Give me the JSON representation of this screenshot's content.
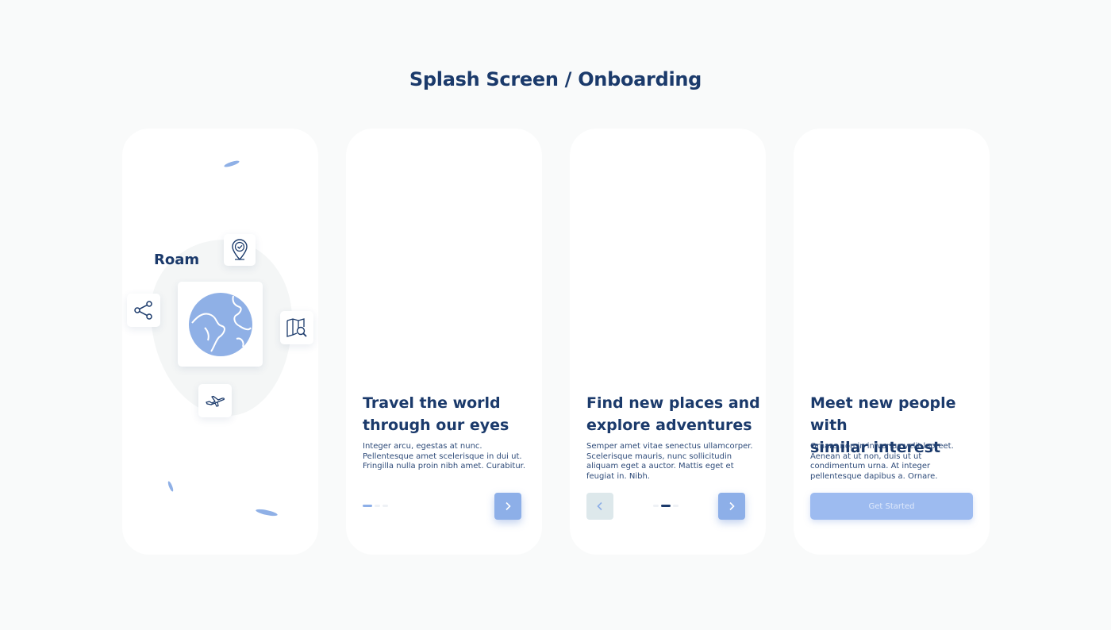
{
  "page": {
    "title": "Splash Screen / Onboarding"
  },
  "splash": {
    "brand": "Roam",
    "icons": [
      "globe-icon",
      "location-check-icon",
      "share-icon",
      "map-search-icon",
      "airplane-icon"
    ]
  },
  "screens": [
    {
      "title_line1": "Travel the world",
      "title_line2": "through our eyes",
      "body": "Integer arcu, egestas at nunc. Pellentesque amet scelerisque in dui ut. Fringilla nulla proin nibh amet. Curabitur.",
      "active_dot": 1
    },
    {
      "title_line1": "Find new  places and",
      "title_line2": "explore  adventures",
      "body": "Semper amet vitae senectus ullamcorper. Scelerisque mauris, nunc sollicitudin aliquam eget a auctor. Mattis eget et feugiat in. Nibh.",
      "active_dot": 2
    },
    {
      "title_line1": "Meet new people with",
      "title_line2": "similar interest",
      "body": "Ornare non in in varius velit laoreet. Aenean at ut non, duis ut ut condimentum urna. At integer pellentesque dapibus a. Ornare.",
      "cta_label": "Get Started"
    }
  ],
  "colors": {
    "primary": "#1b3a6b",
    "accent": "#8dafe8",
    "background": "#f9fafa"
  }
}
